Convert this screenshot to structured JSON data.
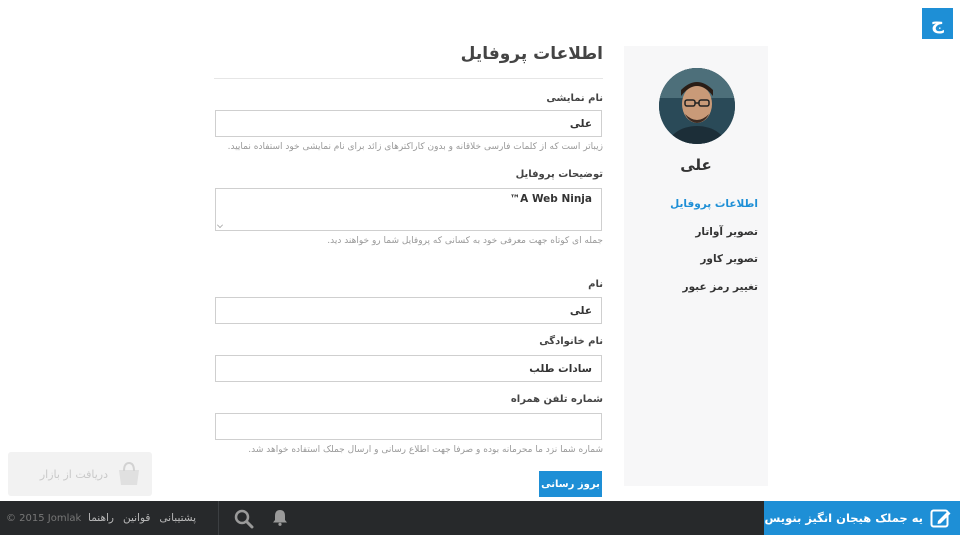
{
  "brand": {
    "logo_letter": "ج",
    "accent": "#1e8fd6"
  },
  "sidebar": {
    "user_name": "علی",
    "menu": [
      {
        "label": "اطلاعات پروفایل",
        "active": true
      },
      {
        "label": "تصویر آواتار",
        "active": false
      },
      {
        "label": "تصویر کاور",
        "active": false
      },
      {
        "label": "تغییر رمز عبور",
        "active": false
      }
    ]
  },
  "form": {
    "title": "اطلاعات پروفایل",
    "display_name": {
      "label": "نام نمایشی",
      "value": "علی",
      "help": "زیباتر است که از کلمات فارسی خلاقانه و بدون کاراکترهای زائد برای نام نمایشی خود استفاده نمایید."
    },
    "bio": {
      "label": "توضیحات پروفایل",
      "value": "A Web Ninja™",
      "help": "جمله ای کوتاه جهت معرفی خود به کسانی که پروفایل شما رو خواهند دید."
    },
    "first_name": {
      "label": "نام",
      "value": "علی"
    },
    "last_name": {
      "label": "نام خانوادگی",
      "value": "سادات طلب"
    },
    "mobile": {
      "label": "شماره تلفن همراه",
      "value": "",
      "help": "شماره شما نزد ما محرمانه بوده و صرفا جهت اطلاع رسانی و ارسال جملک استفاده خواهد شد."
    },
    "save_label": "بروز رسانی"
  },
  "bazaar": {
    "label": "دریافت از بازار"
  },
  "footer": {
    "compose_label": "یه جملک هیجان انگیز بنویس",
    "links": [
      "پشتیبانی",
      "قوانین",
      "راهنما"
    ],
    "copyright": "© 2015 Jomlak"
  }
}
